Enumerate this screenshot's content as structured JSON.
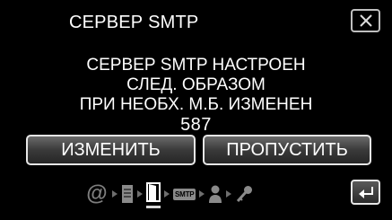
{
  "header": {
    "title": "СЕРВЕР SMTP",
    "close_icon": "close-icon"
  },
  "message": {
    "line1": "СЕРВЕР SMTP НАСТРОЕН",
    "line2": "СЛЕД. ОБРАЗОМ",
    "line3": "ПРИ НЕОБХ. М.Б. ИЗМЕНЕН",
    "port": "587"
  },
  "buttons": {
    "change_label": "ИЗМЕНИТЬ",
    "skip_label": "ПРОПУСТИТЬ"
  },
  "steps": {
    "icons": [
      "at-sign-icon",
      "server-icon",
      "door-icon",
      "smtp-icon",
      "user-icon",
      "key-icon"
    ],
    "smtp_badge": "SMTP",
    "at_symbol": "@",
    "current_step": 3
  },
  "footer": {
    "back_icon": "return-icon"
  }
}
